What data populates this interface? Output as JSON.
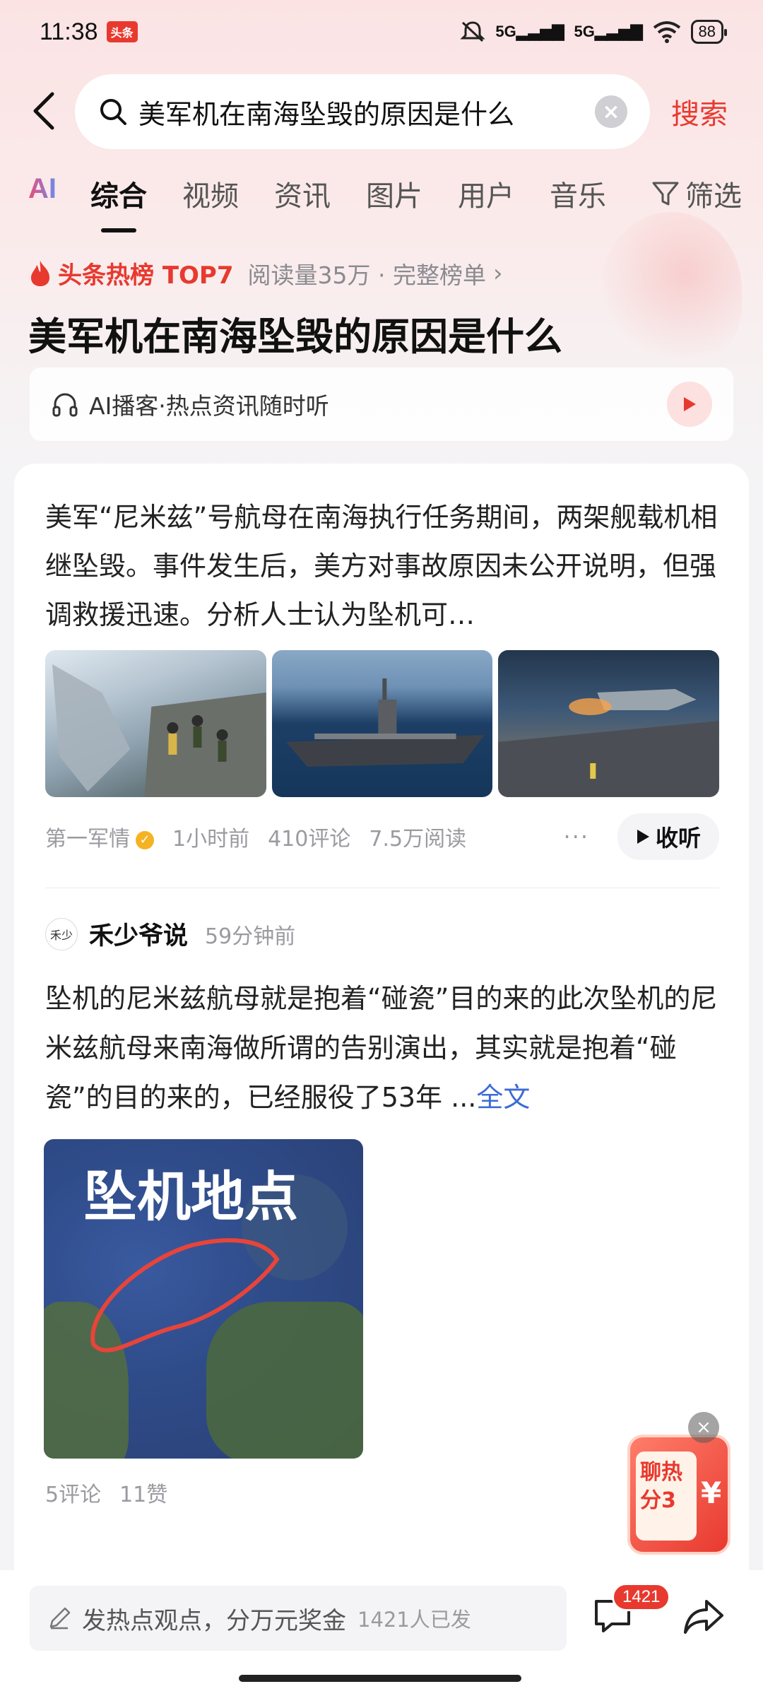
{
  "status_bar": {
    "time": "11:38",
    "app_badge": "头条",
    "signal1": "5G",
    "signal2": "5G",
    "battery": "88"
  },
  "search": {
    "query": "美军机在南海坠毁的原因是什么",
    "button": "搜索"
  },
  "tabs": [
    {
      "label": "AI"
    },
    {
      "label": "综合"
    },
    {
      "label": "视频"
    },
    {
      "label": "资讯"
    },
    {
      "label": "图片"
    },
    {
      "label": "用户"
    },
    {
      "label": "音乐"
    }
  ],
  "filter_label": "筛选",
  "hot": {
    "label": "头条热榜 TOP7",
    "meta": "阅读量35万 · 完整榜单",
    "title": "美军机在南海坠毁的原因是什么"
  },
  "podcast": {
    "text": "AI播客·热点资讯随时听"
  },
  "article": {
    "summary": "美军“尼米兹”号航母在南海执行任务期间，两架舰载机相继坠毁。事件发生后，美方对事故原因未公开说明，但强调救援迅速。分析人士认为坠机可…",
    "source": "第一军情",
    "time": "1小时前",
    "comments": "410评论",
    "reads": "7.5万阅读",
    "more": "···",
    "listen": "收听"
  },
  "post": {
    "avatar_text": "禾少",
    "author": "禾少爷说",
    "time": "59分钟前",
    "body": "坠机的尼米兹航母就是抱着“碰瓷”目的来的此次坠机的尼米兹航母来南海做所谓的告别演出，其实就是抱着“碰瓷”的目的来的，已经服役了53年",
    "ellipsis": "...",
    "fulltext": "全文",
    "image_caption": "坠机地点",
    "comments": "5评论",
    "likes": "11赞"
  },
  "float_ad": {
    "text": "聊热分3",
    "yen": "¥"
  },
  "bottom": {
    "placeholder": "发热点观点，分万元奖金",
    "count": "1421人已发",
    "msg_badge": "1421"
  },
  "colors": {
    "accent_red": "#e8392f",
    "link_blue": "#3d6bd6"
  }
}
